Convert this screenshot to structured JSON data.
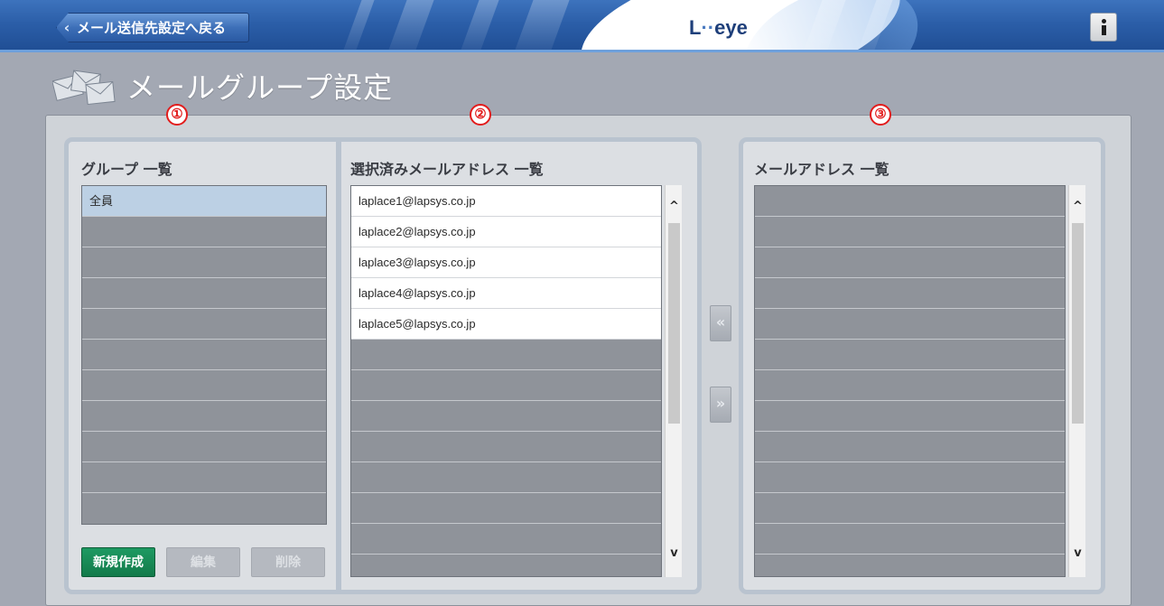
{
  "header": {
    "back_label": "メール送信先設定へ戻る",
    "logo_text": "L-eye",
    "logo_L": "L",
    "logo_dots": "··",
    "logo_eye": "eye",
    "info_icon": "info-icon"
  },
  "page": {
    "title": "メールグループ設定"
  },
  "badges": [
    "①",
    "②",
    "③"
  ],
  "group_list": {
    "title": "グループ 一覧",
    "items": [
      "全員",
      "",
      "",
      "",
      "",
      "",
      "",
      "",
      "",
      "",
      ""
    ],
    "selected_index": 0
  },
  "selected_list": {
    "title": "選択済みメールアドレス 一覧",
    "items": [
      "laplace1@lapsys.co.jp",
      "laplace2@lapsys.co.jp",
      "laplace3@lapsys.co.jp",
      "laplace4@lapsys.co.jp",
      "laplace5@lapsys.co.jp"
    ]
  },
  "address_list": {
    "title": "メールアドレス 一覧",
    "items": []
  },
  "buttons": {
    "new": "新規作成",
    "edit": "編集",
    "delete": "削除",
    "move_left": "«",
    "move_right": "»"
  },
  "colors": {
    "header_blue": "#2b5ea8",
    "new_button_green": "#1e9a62",
    "badge_red": "#e21c1c",
    "selected_row": "#bcd0e4"
  }
}
